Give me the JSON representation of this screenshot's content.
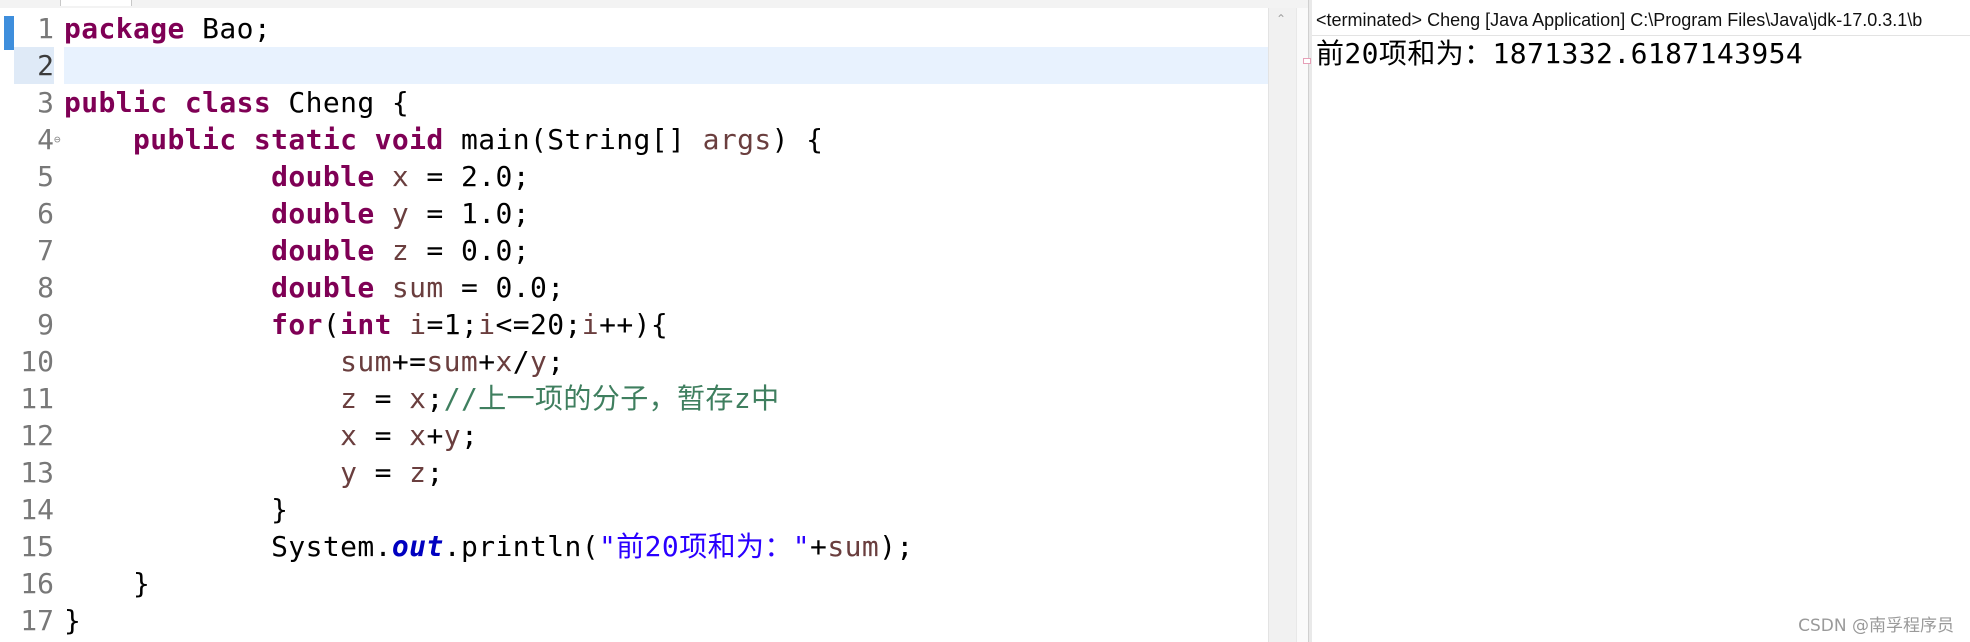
{
  "editor": {
    "current_line": 2,
    "lines": [
      {
        "num": "1",
        "tokens": [
          {
            "t": "package",
            "c": "kw"
          },
          {
            "t": " Bao;",
            "c": ""
          }
        ]
      },
      {
        "num": "2",
        "tokens": []
      },
      {
        "num": "3",
        "tokens": [
          {
            "t": "public",
            "c": "kw"
          },
          {
            "t": " ",
            "c": ""
          },
          {
            "t": "class",
            "c": "kw"
          },
          {
            "t": " Cheng {",
            "c": ""
          }
        ]
      },
      {
        "num": "4",
        "fold": true,
        "tokens": [
          {
            "t": "    ",
            "c": ""
          },
          {
            "t": "public",
            "c": "kw"
          },
          {
            "t": " ",
            "c": ""
          },
          {
            "t": "static",
            "c": "kw"
          },
          {
            "t": " ",
            "c": ""
          },
          {
            "t": "void",
            "c": "kw"
          },
          {
            "t": " main(String[] ",
            "c": ""
          },
          {
            "t": "args",
            "c": "param"
          },
          {
            "t": ") {",
            "c": ""
          }
        ]
      },
      {
        "num": "5",
        "tokens": [
          {
            "t": "            ",
            "c": ""
          },
          {
            "t": "double",
            "c": "kw"
          },
          {
            "t": " ",
            "c": ""
          },
          {
            "t": "x",
            "c": "var"
          },
          {
            "t": " = 2.0;",
            "c": ""
          }
        ]
      },
      {
        "num": "6",
        "tokens": [
          {
            "t": "            ",
            "c": ""
          },
          {
            "t": "double",
            "c": "kw"
          },
          {
            "t": " ",
            "c": ""
          },
          {
            "t": "y",
            "c": "var"
          },
          {
            "t": " = 1.0;",
            "c": ""
          }
        ]
      },
      {
        "num": "7",
        "tokens": [
          {
            "t": "            ",
            "c": ""
          },
          {
            "t": "double",
            "c": "kw"
          },
          {
            "t": " ",
            "c": ""
          },
          {
            "t": "z",
            "c": "var"
          },
          {
            "t": " = 0.0;",
            "c": ""
          }
        ]
      },
      {
        "num": "8",
        "tokens": [
          {
            "t": "            ",
            "c": ""
          },
          {
            "t": "double",
            "c": "kw"
          },
          {
            "t": " ",
            "c": ""
          },
          {
            "t": "sum",
            "c": "var"
          },
          {
            "t": " = 0.0;",
            "c": ""
          }
        ]
      },
      {
        "num": "9",
        "tokens": [
          {
            "t": "            ",
            "c": ""
          },
          {
            "t": "for",
            "c": "kw"
          },
          {
            "t": "(",
            "c": ""
          },
          {
            "t": "int",
            "c": "kw"
          },
          {
            "t": " ",
            "c": ""
          },
          {
            "t": "i",
            "c": "var"
          },
          {
            "t": "=1;",
            "c": ""
          },
          {
            "t": "i",
            "c": "var"
          },
          {
            "t": "<=20;",
            "c": ""
          },
          {
            "t": "i",
            "c": "var"
          },
          {
            "t": "++){",
            "c": ""
          }
        ]
      },
      {
        "num": "10",
        "tokens": [
          {
            "t": "                ",
            "c": ""
          },
          {
            "t": "sum",
            "c": "var"
          },
          {
            "t": "+=",
            "c": ""
          },
          {
            "t": "sum",
            "c": "var"
          },
          {
            "t": "+",
            "c": ""
          },
          {
            "t": "x",
            "c": "var"
          },
          {
            "t": "/",
            "c": ""
          },
          {
            "t": "y",
            "c": "var"
          },
          {
            "t": ";",
            "c": ""
          }
        ]
      },
      {
        "num": "11",
        "tokens": [
          {
            "t": "                ",
            "c": ""
          },
          {
            "t": "z",
            "c": "var"
          },
          {
            "t": " = ",
            "c": ""
          },
          {
            "t": "x",
            "c": "var"
          },
          {
            "t": ";",
            "c": ""
          },
          {
            "t": "//上一项的分子，暂存z中",
            "c": "cmt"
          }
        ]
      },
      {
        "num": "12",
        "tokens": [
          {
            "t": "                ",
            "c": ""
          },
          {
            "t": "x",
            "c": "var"
          },
          {
            "t": " = ",
            "c": ""
          },
          {
            "t": "x",
            "c": "var"
          },
          {
            "t": "+",
            "c": ""
          },
          {
            "t": "y",
            "c": "var"
          },
          {
            "t": ";",
            "c": ""
          }
        ]
      },
      {
        "num": "13",
        "tokens": [
          {
            "t": "                ",
            "c": ""
          },
          {
            "t": "y",
            "c": "var"
          },
          {
            "t": " = ",
            "c": ""
          },
          {
            "t": "z",
            "c": "var"
          },
          {
            "t": ";",
            "c": ""
          }
        ]
      },
      {
        "num": "14",
        "tokens": [
          {
            "t": "            }",
            "c": ""
          }
        ]
      },
      {
        "num": "15",
        "tokens": [
          {
            "t": "            System.",
            "c": ""
          },
          {
            "t": "out",
            "c": "static-field"
          },
          {
            "t": ".println(",
            "c": ""
          },
          {
            "t": "\"前20项和为：\"",
            "c": "str"
          },
          {
            "t": "+",
            "c": ""
          },
          {
            "t": "sum",
            "c": "var"
          },
          {
            "t": ");",
            "c": ""
          }
        ]
      },
      {
        "num": "16",
        "tokens": [
          {
            "t": "    }",
            "c": ""
          }
        ]
      },
      {
        "num": "17",
        "tokens": [
          {
            "t": "}",
            "c": ""
          }
        ]
      }
    ]
  },
  "console": {
    "header": "<terminated> Cheng [Java Application] C:\\Program Files\\Java\\jdk-17.0.3.1\\b",
    "output": "前20项和为：1871332.6187143954"
  },
  "watermark": "CSDN @南孚程序员",
  "colors": {
    "keyword": "#7f0055",
    "local_variable": "#6a3e3e",
    "static_field": "#0000c0",
    "string": "#2a00ff",
    "comment": "#3f7f5f",
    "current_line": "#e8f2fe"
  }
}
